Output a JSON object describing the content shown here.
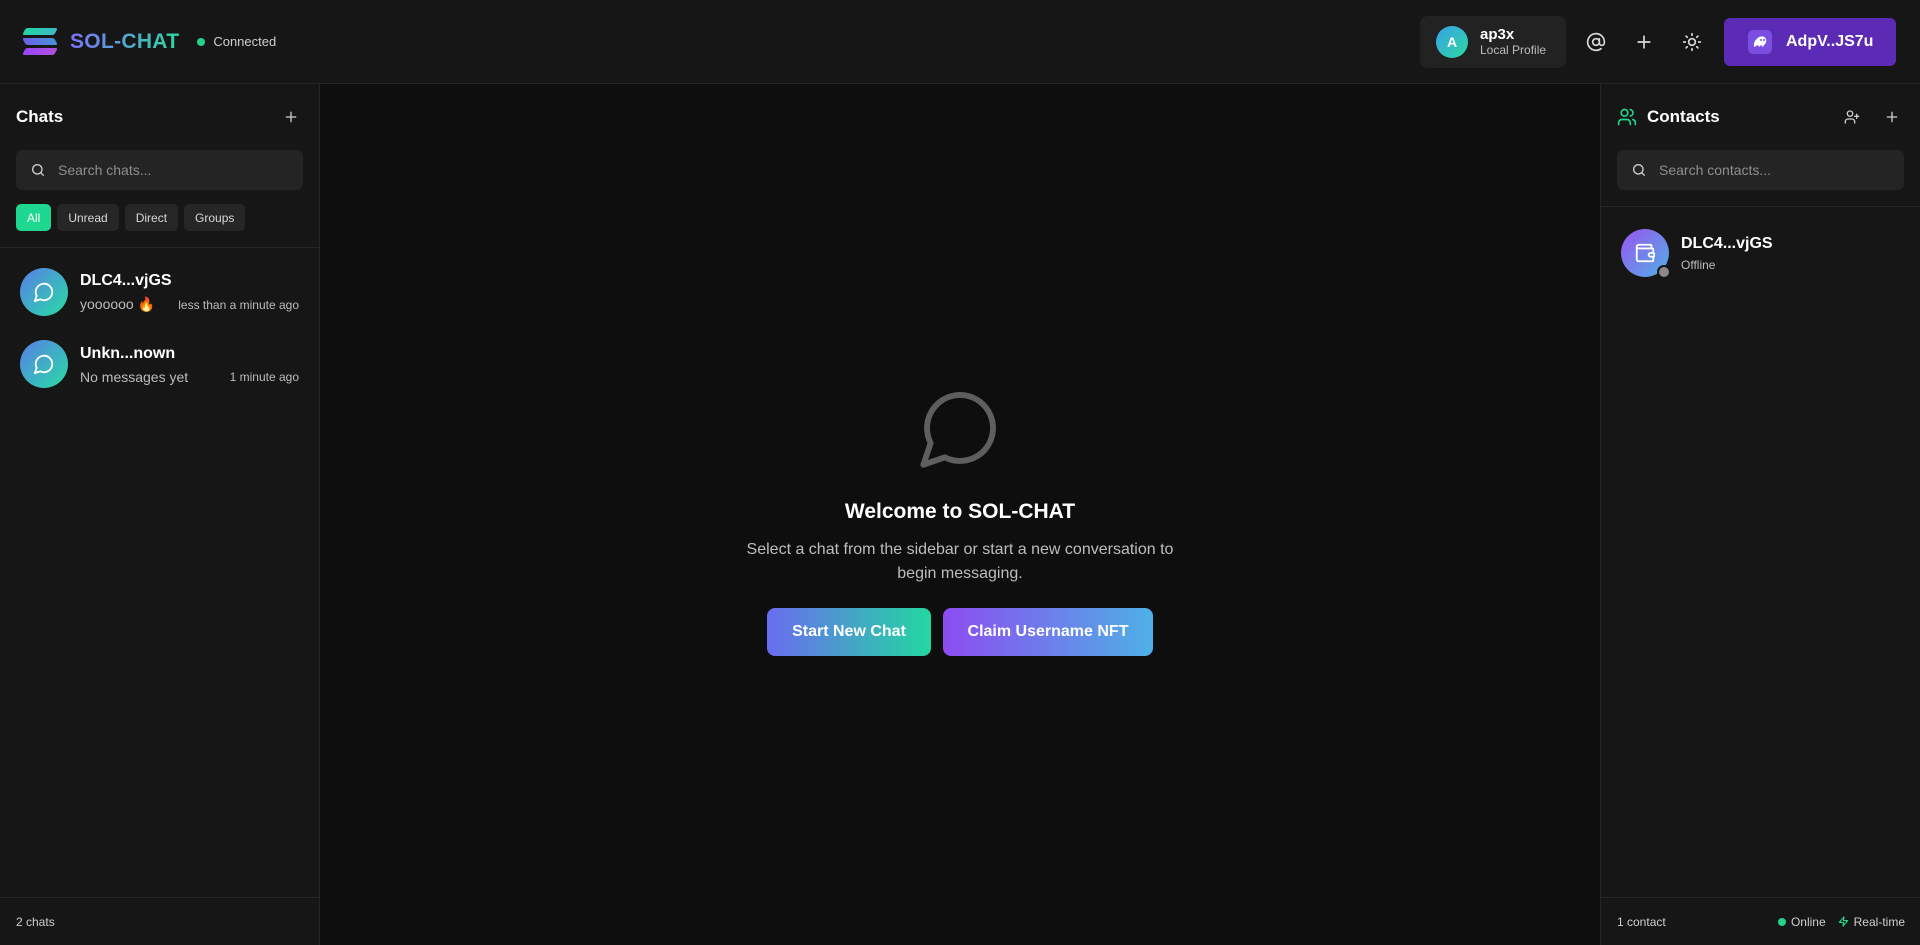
{
  "header": {
    "app_name": "SOL-CHAT",
    "connection_status": "Connected",
    "profile": {
      "initial": "A",
      "name": "ap3x",
      "subtitle": "Local Profile"
    },
    "icons": [
      "at-icon",
      "plus-icon",
      "sun-icon"
    ],
    "wallet_label": "AdpV..JS7u"
  },
  "chats": {
    "title": "Chats",
    "search_placeholder": "Search chats...",
    "filters": [
      "All",
      "Unread",
      "Direct",
      "Groups"
    ],
    "active_filter": "All",
    "items": [
      {
        "name": "DLC4...vjGS",
        "preview": "yoooooo 🔥",
        "time": "less than a minute ago"
      },
      {
        "name": "Unkn...nown",
        "preview": "No messages yet",
        "time": "1 minute ago"
      }
    ],
    "footer": "2 chats"
  },
  "main": {
    "title": "Welcome to SOL-CHAT",
    "text": "Select a chat from the sidebar or start a new conversation to begin messaging.",
    "start_label": "Start New Chat",
    "claim_label": "Claim Username NFT"
  },
  "contacts": {
    "title": "Contacts",
    "search_placeholder": "Search contacts...",
    "items": [
      {
        "name": "DLC4...vjGS",
        "status": "Offline"
      }
    ],
    "footer_count": "1 contact",
    "footer_online": "Online",
    "footer_realtime": "Real-time"
  },
  "colors": {
    "accent_green": "#22d38a",
    "wallet_purple": "#5b2bb5",
    "background": "#0e0e0e",
    "panel": "#161616"
  }
}
